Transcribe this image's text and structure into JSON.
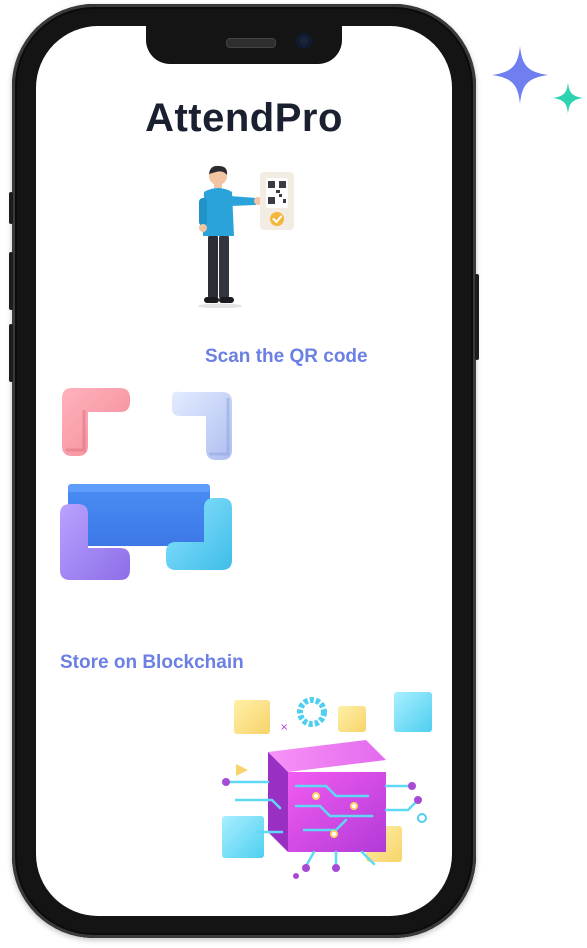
{
  "app": {
    "title": "AttendPro"
  },
  "steps": [
    {
      "caption": "Scan the QR code"
    },
    {
      "caption": "Store on Blockchain"
    }
  ],
  "icons": {
    "sparkle": "sparkle-icon",
    "person_qr": "person-scanning-qr-icon",
    "scan_frame": "qr-scan-frame-icon",
    "blockchain": "blockchain-cube-icon"
  },
  "colors": {
    "title": "#1a2030",
    "caption": "#6c7fe3",
    "sparkle_blue": "#6f7ff0",
    "sparkle_green": "#2ed3b0"
  }
}
